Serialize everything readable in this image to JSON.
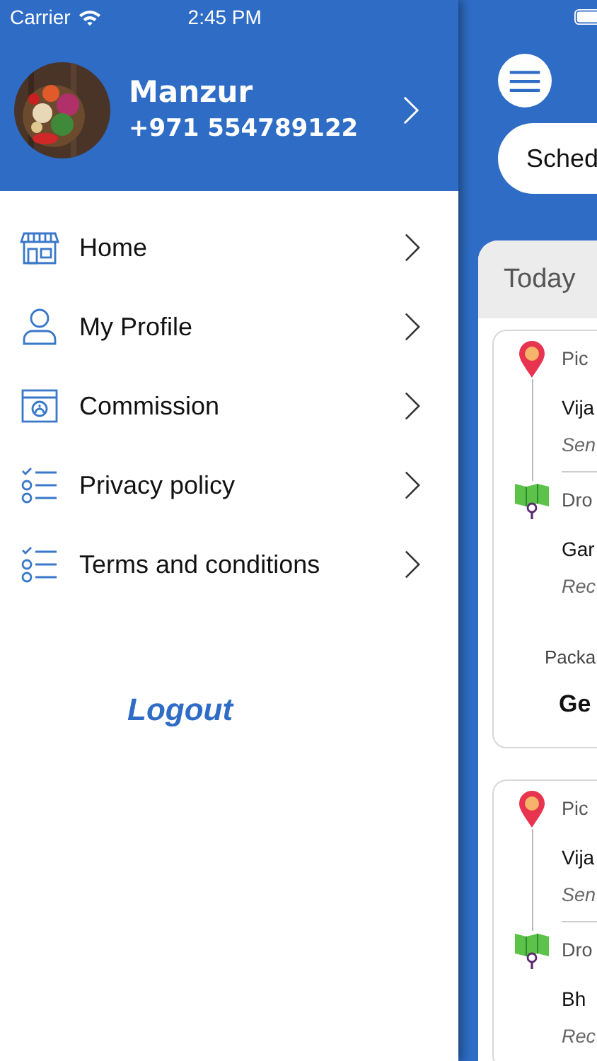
{
  "status_bar": {
    "carrier": "Carrier",
    "time": "2:45 PM"
  },
  "drawer": {
    "profile": {
      "name": "Manzur",
      "phone": "+971 554789122"
    },
    "menu": [
      {
        "label": "Home"
      },
      {
        "label": "My Profile"
      },
      {
        "label": "Commission"
      },
      {
        "label": "Privacy policy"
      },
      {
        "label": "Terms and conditions"
      }
    ],
    "logout": "Logout"
  },
  "main": {
    "tab": "Sched",
    "section": "Today",
    "orders": [
      {
        "pickup_label": "Pic",
        "pickup_name": "Vija",
        "sender": "Sen",
        "drop_label": "Dro",
        "drop_name": "Gar",
        "receiver": "Rec",
        "package_label": "Packa",
        "package_value": "Ge"
      },
      {
        "pickup_label": "Pic",
        "pickup_name": "Vija",
        "sender": "Sen",
        "drop_label": "Dro",
        "drop_name": "Bh",
        "receiver": "Rec"
      }
    ]
  }
}
